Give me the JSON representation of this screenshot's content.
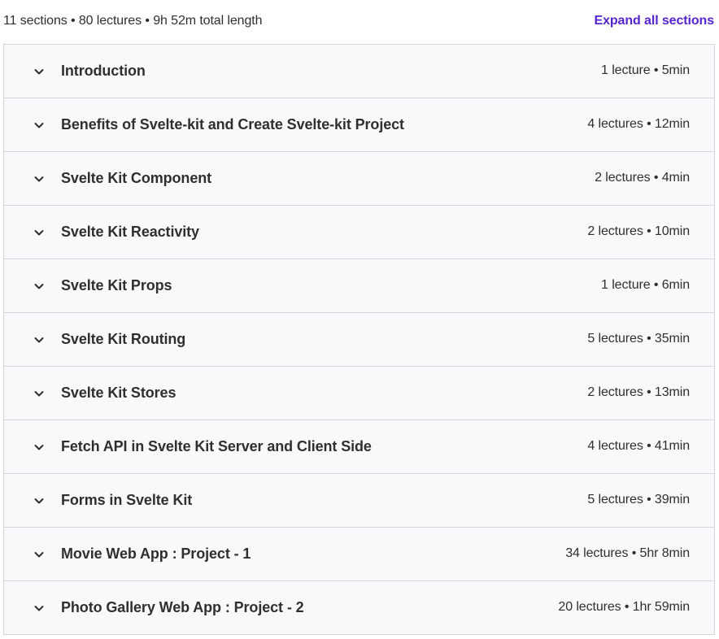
{
  "summary": {
    "text": "11 sections • 80 lectures • 9h 52m total length",
    "expand_label": "Expand all sections"
  },
  "colors": {
    "accent": "#5624d0",
    "row_bg": "#f7f9fa",
    "border": "#d1d7dc",
    "text": "#2d2f31"
  },
  "sections": [
    {
      "title": "Introduction",
      "meta": "1 lecture • 5min",
      "icon": "chevron-down-icon"
    },
    {
      "title": "Benefits of Svelte-kit and Create Svelte-kit Project",
      "meta": "4 lectures • 12min",
      "icon": "chevron-down-icon"
    },
    {
      "title": "Svelte Kit Component",
      "meta": "2 lectures • 4min",
      "icon": "chevron-down-icon"
    },
    {
      "title": "Svelte Kit Reactivity",
      "meta": "2 lectures • 10min",
      "icon": "chevron-down-icon"
    },
    {
      "title": "Svelte Kit Props",
      "meta": "1 lecture • 6min",
      "icon": "chevron-down-icon"
    },
    {
      "title": "Svelte Kit Routing",
      "meta": "5 lectures • 35min",
      "icon": "chevron-down-icon"
    },
    {
      "title": "Svelte Kit Stores",
      "meta": "2 lectures • 13min",
      "icon": "chevron-down-icon"
    },
    {
      "title": "Fetch API in Svelte Kit Server and Client Side",
      "meta": "4 lectures • 41min",
      "icon": "chevron-down-icon"
    },
    {
      "title": "Forms in Svelte Kit",
      "meta": "5 lectures • 39min",
      "icon": "chevron-down-icon"
    },
    {
      "title": "Movie Web App : Project - 1",
      "meta": "34 lectures • 5hr 8min",
      "icon": "chevron-down-icon"
    },
    {
      "title": "Photo Gallery Web App : Project - 2",
      "meta": "20 lectures • 1hr 59min",
      "icon": "chevron-down-icon"
    }
  ]
}
